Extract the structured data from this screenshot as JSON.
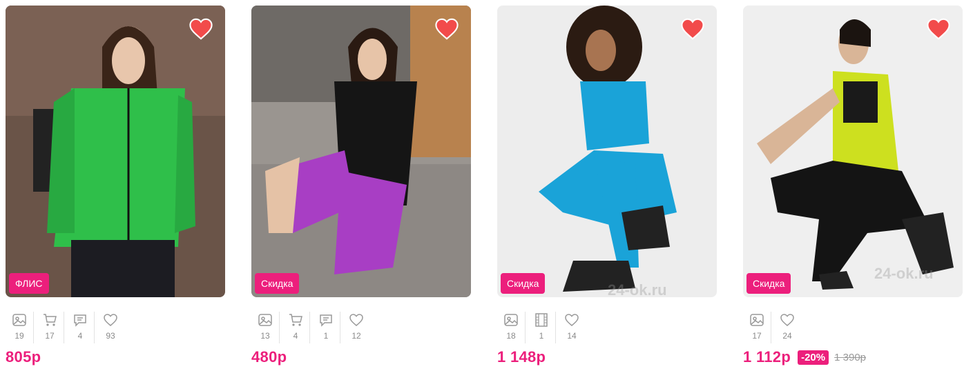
{
  "products": [
    {
      "badge": "ФЛИС",
      "stats": [
        {
          "icon": "photo-icon",
          "value": "19"
        },
        {
          "icon": "cart-icon",
          "value": "17"
        },
        {
          "icon": "comment-icon",
          "value": "4"
        },
        {
          "icon": "heart-outline-icon",
          "value": "93"
        }
      ],
      "price": "805р",
      "discount": "",
      "old_price": "",
      "colors": {
        "bg": "#5a4a42",
        "top": "#2fbf4a",
        "bottom": "#1c1c22"
      }
    },
    {
      "badge": "Скидка",
      "stats": [
        {
          "icon": "photo-icon",
          "value": "13"
        },
        {
          "icon": "cart-icon",
          "value": "4"
        },
        {
          "icon": "comment-icon",
          "value": "1"
        },
        {
          "icon": "heart-outline-icon",
          "value": "12"
        }
      ],
      "price": "480р",
      "discount": "",
      "old_price": "",
      "colors": {
        "bg": "#8a8581",
        "top": "#151515",
        "bottom": "#a83ec4"
      }
    },
    {
      "badge": "Скидка",
      "stats": [
        {
          "icon": "photo-icon",
          "value": "18"
        },
        {
          "icon": "film-icon",
          "value": "1"
        },
        {
          "icon": "heart-outline-icon",
          "value": "14"
        }
      ],
      "price": "1 148р",
      "discount": "",
      "old_price": "",
      "colors": {
        "bg": "#ededed",
        "top": "#1aa3d8",
        "bottom": "#1aa3d8"
      }
    },
    {
      "badge": "Скидка",
      "stats": [
        {
          "icon": "photo-icon",
          "value": "17"
        },
        {
          "icon": "heart-outline-icon",
          "value": "24"
        }
      ],
      "price": "1 112р",
      "discount": "-20%",
      "old_price": "1 390р",
      "colors": {
        "bg": "#efefef",
        "top": "#cde01f",
        "bottom": "#141414"
      }
    }
  ],
  "watermark": "24-ok.ru",
  "accent": "#ec1f7c",
  "favorite_color": "#f24b4b"
}
